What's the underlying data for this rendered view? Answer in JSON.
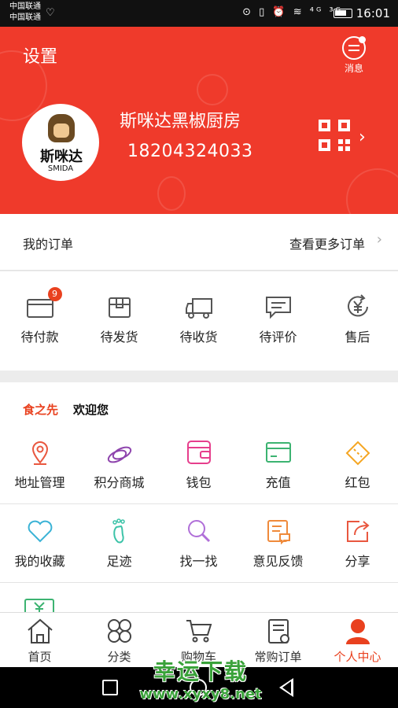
{
  "status_bar": {
    "carrier_1": "中国联通",
    "carrier_2": "中国联通",
    "icons": "⊙ ▯ ⏰ ≋ ⁴ᴳ ³ᴳ",
    "time": "16:01"
  },
  "header": {
    "title": "设置",
    "message_label": "消息",
    "shop_name": "斯咪达黑椒厨房",
    "phone": "18204324033",
    "avatar_logo": "斯咪达",
    "avatar_sub": "SMIDA",
    "background_color": "#ef3a2b"
  },
  "orders": {
    "label": "我的订单",
    "more": "查看更多订单",
    "items": [
      {
        "label": "待付款",
        "badge": "9",
        "icon": "card-icon"
      },
      {
        "label": "待发货",
        "icon": "box-icon"
      },
      {
        "label": "待收货",
        "icon": "truck-icon"
      },
      {
        "label": "待评价",
        "icon": "comment-icon"
      },
      {
        "label": "售后",
        "icon": "yuan-refund-icon"
      }
    ]
  },
  "welcome": {
    "brand": "食之先",
    "text": "欢迎您"
  },
  "services": {
    "row1": [
      {
        "label": "地址管理",
        "icon": "location-icon",
        "color": "#e9573f"
      },
      {
        "label": "积分商城",
        "icon": "coins-icon",
        "color": "#8e44ad"
      },
      {
        "label": "钱包",
        "icon": "wallet-icon",
        "color": "#e63e8c"
      },
      {
        "label": "充值",
        "icon": "recharge-card-icon",
        "color": "#3cb371"
      },
      {
        "label": "红包",
        "icon": "coupon-icon",
        "color": "#f5a623"
      }
    ],
    "row2": [
      {
        "label": "我的收藏",
        "icon": "heart-icon",
        "color": "#3bb3d6"
      },
      {
        "label": "足迹",
        "icon": "footprint-icon",
        "color": "#3cc3a8"
      },
      {
        "label": "找一找",
        "icon": "magnifier-icon",
        "color": "#b06fd8"
      },
      {
        "label": "意见反馈",
        "icon": "feedback-icon",
        "color": "#ef8a3b"
      },
      {
        "label": "分享",
        "icon": "share-icon",
        "color": "#e9573f"
      }
    ]
  },
  "tabbar": {
    "items": [
      {
        "label": "首页",
        "icon": "home-icon"
      },
      {
        "label": "分类",
        "icon": "category-icon"
      },
      {
        "label": "购物车",
        "icon": "cart-icon"
      },
      {
        "label": "常购订单",
        "icon": "order-list-icon"
      },
      {
        "label": "个人中心",
        "icon": "profile-icon",
        "active": true
      }
    ],
    "active_color": "#e9411f"
  },
  "watermark": {
    "title": "幸运下载",
    "url": "www.xyxy8.net"
  }
}
